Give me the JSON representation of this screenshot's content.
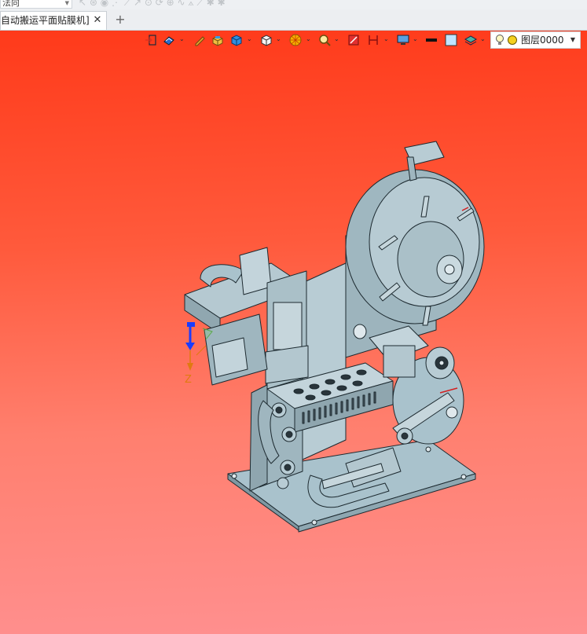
{
  "window": {
    "view_dropdown": "法向",
    "tab_title": "自动搬运平面贴膜机]",
    "tab_close": "✕",
    "tab_add": "+"
  },
  "toolbar": {
    "icons": [
      "exit-sketch-icon",
      "render-style-icon",
      "pencil-icon",
      "box-shaded-icon",
      "cube-icon",
      "view-cube-icon",
      "color-wheel-icon",
      "zoom-fit-icon",
      "section-icon",
      "dimension-icon",
      "display-icon",
      "black-line-icon",
      "square-color-icon",
      "layer-stack-icon"
    ]
  },
  "layer": {
    "label": "图层0000",
    "bulb_icon": "light-bulb-icon",
    "color_icon": "yellow-circle-icon"
  },
  "triad": {
    "axis_label": "Z"
  },
  "colors": {
    "bg_top": "#ff3a1a",
    "bg_bottom": "#ff9090",
    "model_fill": "#a9c2cc",
    "model_edge": "#1d2a30",
    "axis_blue": "#1a3cff",
    "axis_orange": "#e07a10"
  }
}
